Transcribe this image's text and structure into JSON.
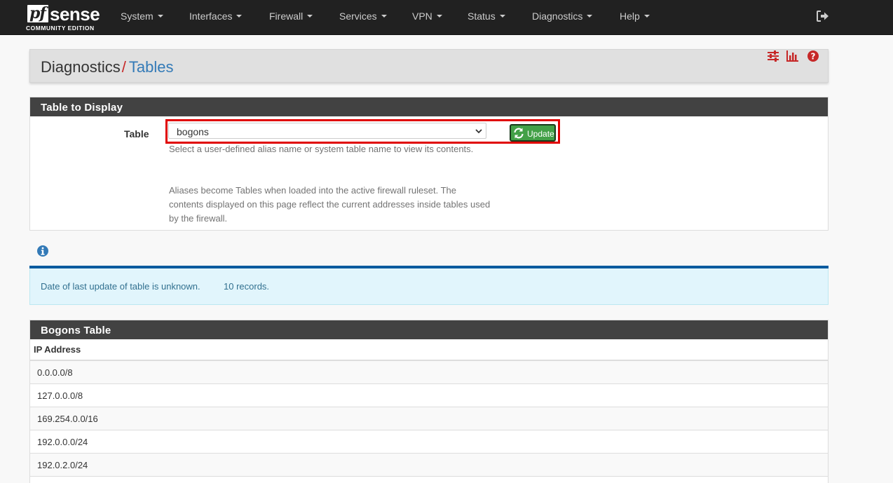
{
  "brand": {
    "logo_pf": "pf",
    "logo_sense": "sense",
    "edition": "COMMUNITY EDITION"
  },
  "nav": {
    "items": [
      {
        "label": "System"
      },
      {
        "label": "Interfaces"
      },
      {
        "label": "Firewall"
      },
      {
        "label": "Services"
      },
      {
        "label": "VPN"
      },
      {
        "label": "Status"
      },
      {
        "label": "Diagnostics"
      },
      {
        "label": "Help"
      }
    ],
    "logout_icon": "sign-out-icon"
  },
  "breadcrumb": {
    "parent": "Diagnostics",
    "separator": "/",
    "current": "Tables"
  },
  "header_icons": [
    "sliders-icon",
    "bar-chart-icon",
    "question-circle-icon"
  ],
  "table_panel": {
    "title": "Table to Display",
    "field_label": "Table",
    "selected": "bogons",
    "update_label": "Update",
    "help_1": "Select a user-defined alias name or system table name to view its contents.",
    "help_2": "Aliases become Tables when loaded into the active firewall ruleset. The contents displayed on this page reflect the current addresses inside tables used by the firewall."
  },
  "info": {
    "icon": "info-circle-icon",
    "last_update": "Date of last update of table is unknown.",
    "records": "10 records."
  },
  "bogons": {
    "title": "Bogons Table",
    "column": "IP Address",
    "rows": [
      "0.0.0.0/8",
      "127.0.0.0/8",
      "169.254.0.0/16",
      "192.0.0.0/24",
      "192.0.2.0/24",
      ""
    ]
  },
  "colors": {
    "navbar": "#212121",
    "panel_head": "#424242",
    "accent_link": "#337ab7",
    "accent_red": "#c62828",
    "success_button": "#43a047",
    "info_bar": "#0b5b9f",
    "alert_bg": "#e1f5fc"
  }
}
